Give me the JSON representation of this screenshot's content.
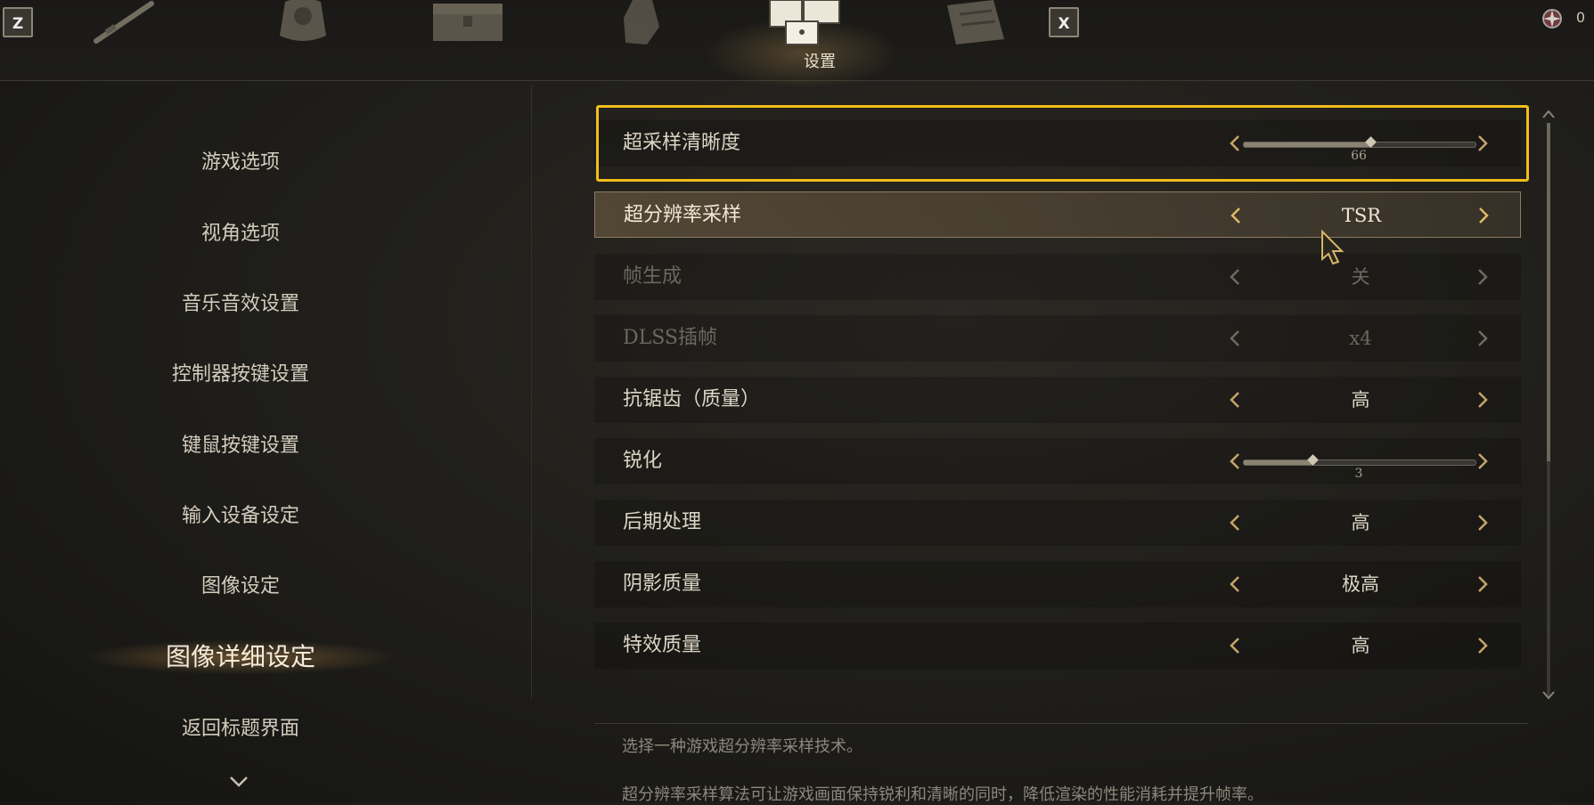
{
  "topbar": {
    "left_key": "Z",
    "right_key": "X",
    "active_tab_label": "设置",
    "currency_value": "0",
    "tabs": [
      "weapon-icon",
      "armor-icon",
      "chest-icon",
      "character-icon",
      "settings-dice-icon",
      "book-icon"
    ]
  },
  "sidebar": {
    "items": [
      {
        "label": "游戏选项"
      },
      {
        "label": "视角选项"
      },
      {
        "label": "音乐音效设置"
      },
      {
        "label": "控制器按键设置"
      },
      {
        "label": "键鼠按键设置"
      },
      {
        "label": "输入设备设定"
      },
      {
        "label": "图像设定"
      },
      {
        "label": "图像详细设定"
      },
      {
        "label": "返回标题界面"
      }
    ],
    "active_index": 7
  },
  "settings": {
    "rows": [
      {
        "label": "超采样清晰度",
        "type": "slider",
        "value": "66",
        "level": 0.55,
        "state": "focused"
      },
      {
        "label": "超分辨率采样",
        "type": "option",
        "value": "TSR",
        "state": "selected"
      },
      {
        "label": "帧生成",
        "type": "option",
        "value": "关",
        "state": "disabled"
      },
      {
        "label": "DLSS插帧",
        "type": "option",
        "value": "x4",
        "state": "disabled"
      },
      {
        "label": "抗锯齿（质量）",
        "type": "option",
        "value": "高",
        "state": "normal"
      },
      {
        "label": "锐化",
        "type": "slider",
        "value": "3",
        "level": 0.3,
        "state": "normal"
      },
      {
        "label": "后期处理",
        "type": "option",
        "value": "高",
        "state": "normal"
      },
      {
        "label": "阴影质量",
        "type": "option",
        "value": "极高",
        "state": "normal"
      },
      {
        "label": "特效质量",
        "type": "option",
        "value": "高",
        "state": "normal"
      }
    ]
  },
  "description": {
    "line1": "选择一种游戏超分辨率采样技术。",
    "line2": "超分辨率采样算法可让游戏画面保持锐利和清晰的同时，降低渲染的性能消耗并提升帧率。"
  },
  "colors": {
    "highlight": "#f2bd1a",
    "accent_gold": "#c8a46a",
    "background": "#201f1b"
  }
}
